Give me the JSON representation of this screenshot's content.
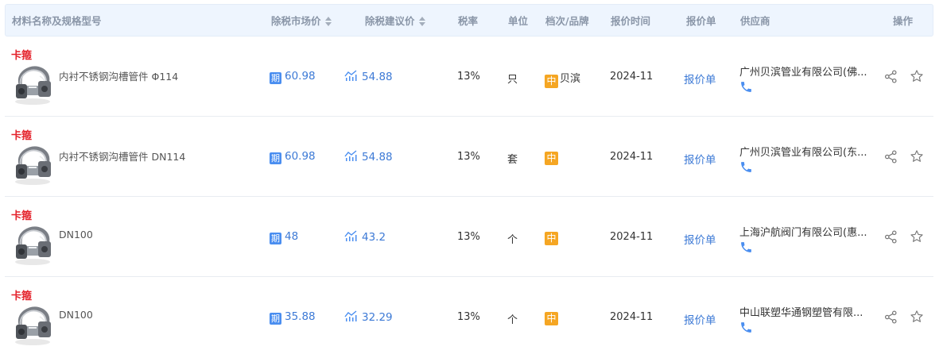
{
  "header": {
    "name": "材料名称及规格型号",
    "market_price": "除税市场价",
    "suggested_price": "除税建议价",
    "tax_rate": "税率",
    "unit": "单位",
    "grade_brand": "档次/品牌",
    "quote_time": "报价时间",
    "quote_sheet": "报价单",
    "supplier": "供应商",
    "actions": "操作"
  },
  "colors": {
    "category": "#e4222b",
    "link_blue": "#3d7ad6",
    "badge_qi": "#4a8ef0",
    "badge_zhong": "#f5a623",
    "header_bg": "#eef5fe"
  },
  "icons": [
    "period-badge",
    "trend-icon",
    "grade-badge",
    "phone-icon",
    "share-icon",
    "star-icon"
  ],
  "rows": [
    {
      "category": "卡箍",
      "name": "内衬不锈钢沟槽管件 Φ114",
      "market_badge": "期",
      "market_price": "60.98",
      "suggested_price": "54.88",
      "tax_rate": "13%",
      "unit": "只",
      "grade": "中",
      "brand": "贝滨",
      "date": "2024-11",
      "quote": "报价单",
      "supplier": "广州贝滨管业有限公司(佛..."
    },
    {
      "category": "卡箍",
      "name": "内衬不锈钢沟槽管件 DN114",
      "market_badge": "期",
      "market_price": "60.98",
      "suggested_price": "54.88",
      "tax_rate": "13%",
      "unit": "套",
      "grade": "中",
      "brand": "",
      "date": "2024-11",
      "quote": "报价单",
      "supplier": "广州贝滨管业有限公司(东..."
    },
    {
      "category": "卡箍",
      "name": "DN100",
      "market_badge": "期",
      "market_price": "48",
      "suggested_price": "43.2",
      "tax_rate": "13%",
      "unit": "个",
      "grade": "中",
      "brand": "",
      "date": "2024-11",
      "quote": "报价单",
      "supplier": "上海沪航阀门有限公司(惠..."
    },
    {
      "category": "卡箍",
      "name": "DN100",
      "market_badge": "期",
      "market_price": "35.88",
      "suggested_price": "32.29",
      "tax_rate": "13%",
      "unit": "个",
      "grade": "中",
      "brand": "",
      "date": "2024-11",
      "quote": "报价单",
      "supplier": "中山联塑华通钢塑管有限..."
    }
  ]
}
